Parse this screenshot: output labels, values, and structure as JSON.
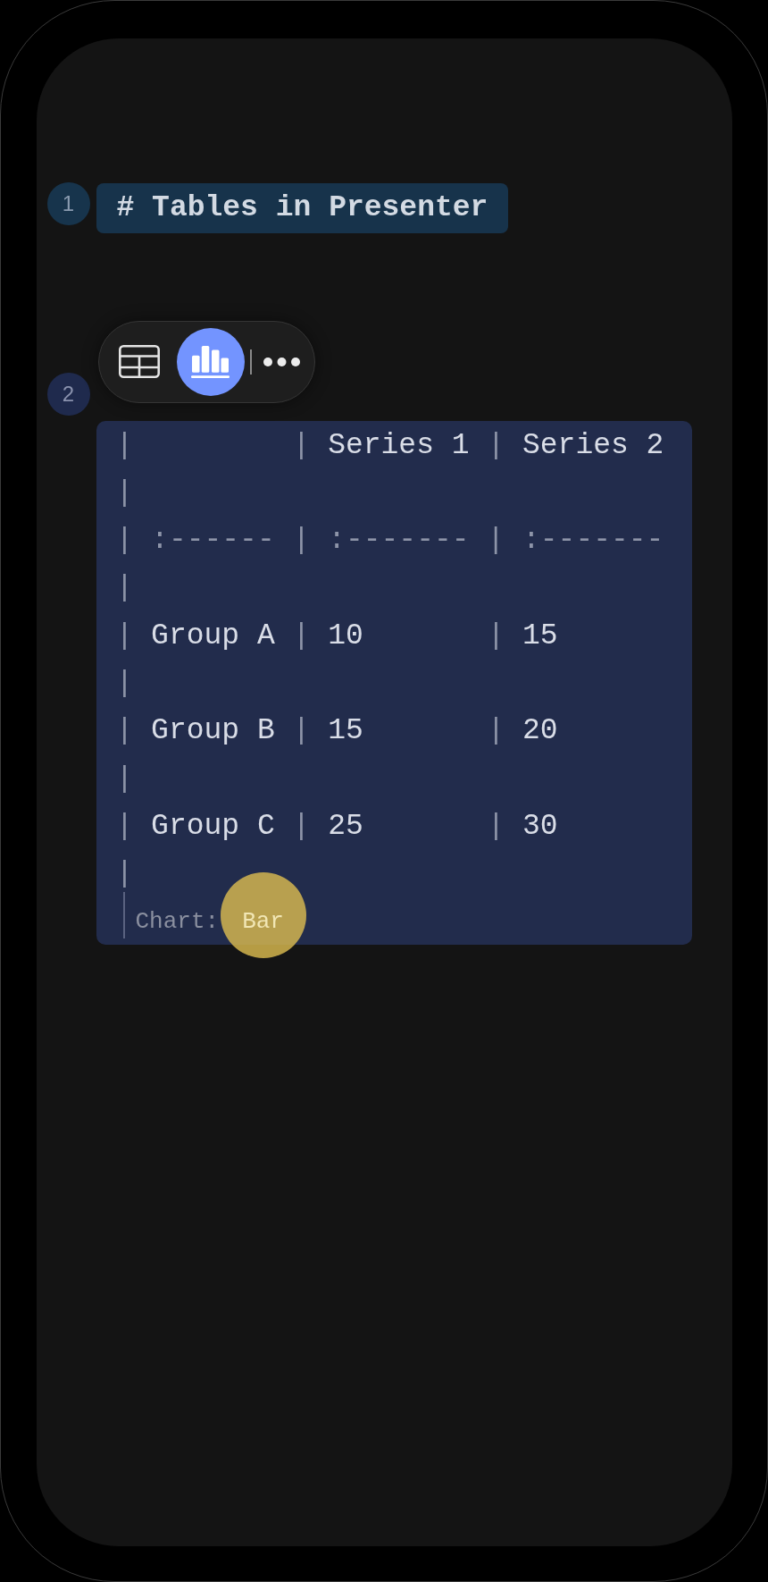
{
  "blocks": [
    {
      "kind": "heading",
      "number": "1",
      "text": "# Tables in Presenter"
    },
    {
      "kind": "table",
      "number": "2",
      "view_options": [
        {
          "kind": "table",
          "selected": false
        },
        {
          "kind": "chart",
          "selected": true
        }
      ],
      "lines": [
        {
          "segments": [
            {
              "kind": "syntax",
              "text": "|         | "
            },
            {
              "kind": "text",
              "text": "Series 1"
            },
            {
              "kind": "syntax",
              "text": " | "
            },
            {
              "kind": "text",
              "text": "Series 2"
            },
            {
              "kind": "syntax",
              "text": " |"
            }
          ]
        },
        {
          "segments": [
            {
              "kind": "syntax",
              "text": "| :------ | :------- | :------- |"
            }
          ]
        },
        {
          "segments": [
            {
              "kind": "syntax",
              "text": "| "
            },
            {
              "kind": "text",
              "text": "Group A"
            },
            {
              "kind": "syntax",
              "text": " | "
            },
            {
              "kind": "text",
              "text": "10"
            },
            {
              "kind": "syntax",
              "text": "       | "
            },
            {
              "kind": "text",
              "text": "15"
            },
            {
              "kind": "syntax",
              "text": "       |"
            }
          ]
        },
        {
          "segments": [
            {
              "kind": "syntax",
              "text": "| "
            },
            {
              "kind": "text",
              "text": "Group B"
            },
            {
              "kind": "syntax",
              "text": " | "
            },
            {
              "kind": "text",
              "text": "15"
            },
            {
              "kind": "syntax",
              "text": "       | "
            },
            {
              "kind": "text",
              "text": "20"
            },
            {
              "kind": "syntax",
              "text": "       |"
            }
          ]
        },
        {
          "segments": [
            {
              "kind": "syntax",
              "text": "| "
            },
            {
              "kind": "text",
              "text": "Group C"
            },
            {
              "kind": "syntax",
              "text": " | "
            },
            {
              "kind": "text",
              "text": "25"
            },
            {
              "kind": "syntax",
              "text": "       | "
            },
            {
              "kind": "text",
              "text": "30"
            },
            {
              "kind": "syntax",
              "text": "       |"
            }
          ]
        }
      ],
      "caption": {
        "label": "Chart:",
        "value": "Bar"
      }
    }
  ]
}
